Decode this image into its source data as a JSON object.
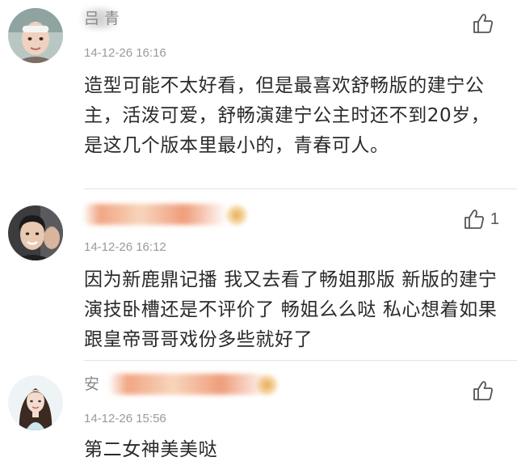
{
  "comments": [
    {
      "username": "吕   青",
      "time": "14-12-26 16:16",
      "content": "造型可能不太好看，但是最喜欢舒畅版的建宁公主，活泼可爱，舒畅演建宁公主时还不到20岁，是这几个版本里最小的，青春可人。",
      "likes": "",
      "avatar": "avatar-photo"
    },
    {
      "username": "",
      "time": "14-12-26 16:12",
      "content": "因为新鹿鼎记播 我又去看了畅姐那版 新版的建宁演技卧槽还是不评价了 畅姐么么哒 私心想着如果跟皇帝哥哥戏份多些就好了",
      "likes": "1",
      "avatar": "avatar-photo"
    },
    {
      "username": "安",
      "time": "14-12-26 15:56",
      "content": "第二女神美美哒",
      "likes": "",
      "avatar": "avatar-photo"
    }
  ],
  "icons": {
    "like": "thumbs-up-icon"
  },
  "colors": {
    "username": "#8a8a8a",
    "time": "#9a9a9a",
    "content": "#2a2a2a",
    "divider": "#e3e3e3"
  }
}
